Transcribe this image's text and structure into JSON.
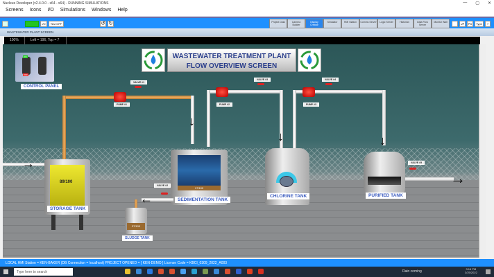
{
  "window": {
    "title": "Nucleus Developer (v2.4.0.0 - x64 - x64) - RUNNING SIMULATIONS",
    "controls": [
      "—",
      "▢",
      "✕"
    ]
  },
  "menu": [
    "Screens",
    "Icons",
    "I/O",
    "Simulations",
    "Windows",
    "Help"
  ],
  "toolbar": {
    "io_label": "I/O",
    "test_label": "Test OFF",
    "tabs": [
      "Project Data",
      "Camera Builder",
      "Display Creator",
      "Simulator",
      "HMI Station",
      "Comms Server",
      "Logic Server",
      "Historian",
      "Data Flow Server",
      "Monitor Wall"
    ],
    "active_tab": "Display Creator",
    "right_buttons": [
      "UP",
      "PD",
      "Type",
      "?"
    ]
  },
  "subwindow": {
    "title": "WASTEWATER PLANT SCREEN",
    "zoom": "100%",
    "position": "Left = 196, Top = 7"
  },
  "screen": {
    "title_line1": "WASTEWATER TREATMENT PLANT",
    "title_line2": "FLOW OVERVIEW SCREEN",
    "control_panel": {
      "label": "CONTROL PANEL",
      "switch_on": "ON",
      "switch_off": "OFF"
    },
    "pumps": [
      "PUMP #1",
      "PUMP #2",
      "PUMP #3"
    ],
    "valves": [
      "VALVE #1",
      "VALVE #2",
      "VALVE #3",
      "VALVE #4",
      "VALVE #5"
    ],
    "tanks": {
      "storage": {
        "label": "STORAGE TANK",
        "level": "89/100",
        "color": "#e6e020"
      },
      "sedimentation": {
        "label": "SEDIMENTATION TANK",
        "level": "17/100",
        "color": "#1e4e8a"
      },
      "sludge": {
        "label": "SLUDGE TANK",
        "level": "37/100"
      },
      "chlorine": {
        "label": "CHLORINE TANK"
      },
      "purified": {
        "label": "PURIFIED TANK"
      }
    }
  },
  "status": "LOCAL HMI Station = KEN-BAKER   (DB Connection = localhost)   PROJECT OPENED = [ KEN-DEMO ]   License Code = KBCI_0309_2022_A003",
  "taskbar": {
    "search_placeholder": "Type here to search",
    "weather": "Rain coming",
    "time": "3:16 PM",
    "date": "3/25/2022"
  }
}
